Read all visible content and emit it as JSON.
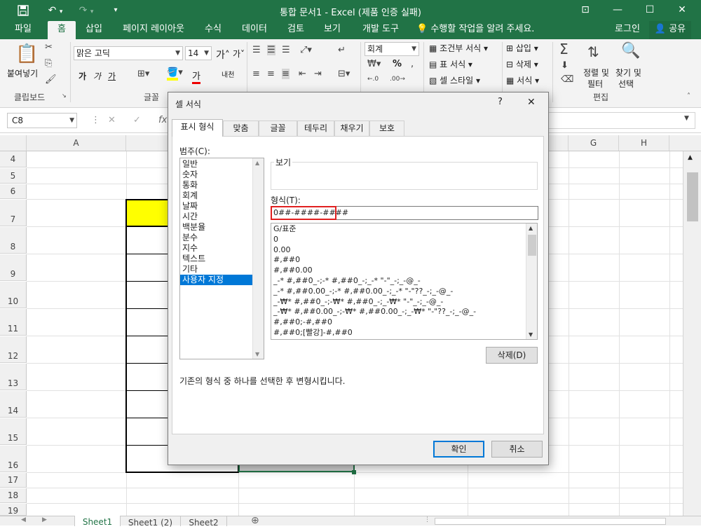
{
  "window": {
    "title": "통합 문서1 - Excel (제품 인증 실패)",
    "save_icon": "save-icon",
    "undo_icon": "undo-icon",
    "redo_icon": "redo-icon"
  },
  "tabs": [
    "파일",
    "홈",
    "삽입",
    "페이지 레이아웃",
    "수식",
    "데이터",
    "검토",
    "보기",
    "개발 도구"
  ],
  "tell_me": "수행할 작업을 알려 주세요.",
  "signin": "로그인",
  "share": "공유",
  "ribbon": {
    "clipboard": {
      "paste": "붙여넣기",
      "label": "클립보드"
    },
    "font": {
      "name": "맑은 고딕",
      "size": "14",
      "label": "글꼴",
      "bold": "가",
      "italic": "가",
      "underline": "가",
      "color_char": "가",
      "phonetic": "내천"
    },
    "number": {
      "format": "회계",
      "percent": "%"
    },
    "styles": {
      "cond": "조건부 서식",
      "table": "표 서식",
      "cell": "셀 스타일"
    },
    "cells": {
      "insert": "삽입",
      "delete": "삭제",
      "format": "서식"
    },
    "editing": {
      "sort": "정렬 및",
      "sort2": "필터",
      "find": "찾기 및",
      "find2": "선택",
      "label": "편집"
    }
  },
  "namebox": "C8",
  "columns": [
    "A",
    "G",
    "H"
  ],
  "rows": [
    "4",
    "5",
    "6",
    "7",
    "8",
    "9",
    "10",
    "11",
    "12",
    "13",
    "14",
    "15",
    "16",
    "17",
    "18",
    "19"
  ],
  "sheets": [
    "Sheet1",
    "Sheet1 (2)",
    "Sheet2"
  ],
  "dialog": {
    "title": "셀 서식",
    "help": "?",
    "close": "✕",
    "tabs": [
      "표시 형식",
      "맞춤",
      "글꼴",
      "테두리",
      "채우기",
      "보호"
    ],
    "category_label": "범주(C):",
    "categories": [
      "일반",
      "숫자",
      "통화",
      "회계",
      "날짜",
      "시간",
      "백분율",
      "분수",
      "지수",
      "텍스트",
      "기타",
      "사용자 지정"
    ],
    "sample_label": "보기",
    "type_label": "형식(T):",
    "type_value": "0##-####-####",
    "formats": [
      "G/표준",
      "0",
      "0.00",
      "#,##0",
      "#,##0.00",
      "_-* #,##0_-;-* #,##0_-;_-* \"-\"_-;_-@_-",
      "_-* #,##0.00_-;-* #,##0.00_-;_-* \"-\"??_-;_-@_-",
      "_-₩* #,##0_-;-₩* #,##0_-;_-₩* \"-\"_-;_-@_-",
      "_-₩* #,##0.00_-;-₩* #,##0.00_-;_-₩* \"-\"??_-;_-@_-",
      "#,##0;-#,##0",
      "#,##0;[빨강]-#,##0"
    ],
    "delete_btn": "삭제(D)",
    "description": "기존의 형식 중 하나를 선택한 후 변형시킵니다.",
    "ok": "확인",
    "cancel": "취소"
  }
}
